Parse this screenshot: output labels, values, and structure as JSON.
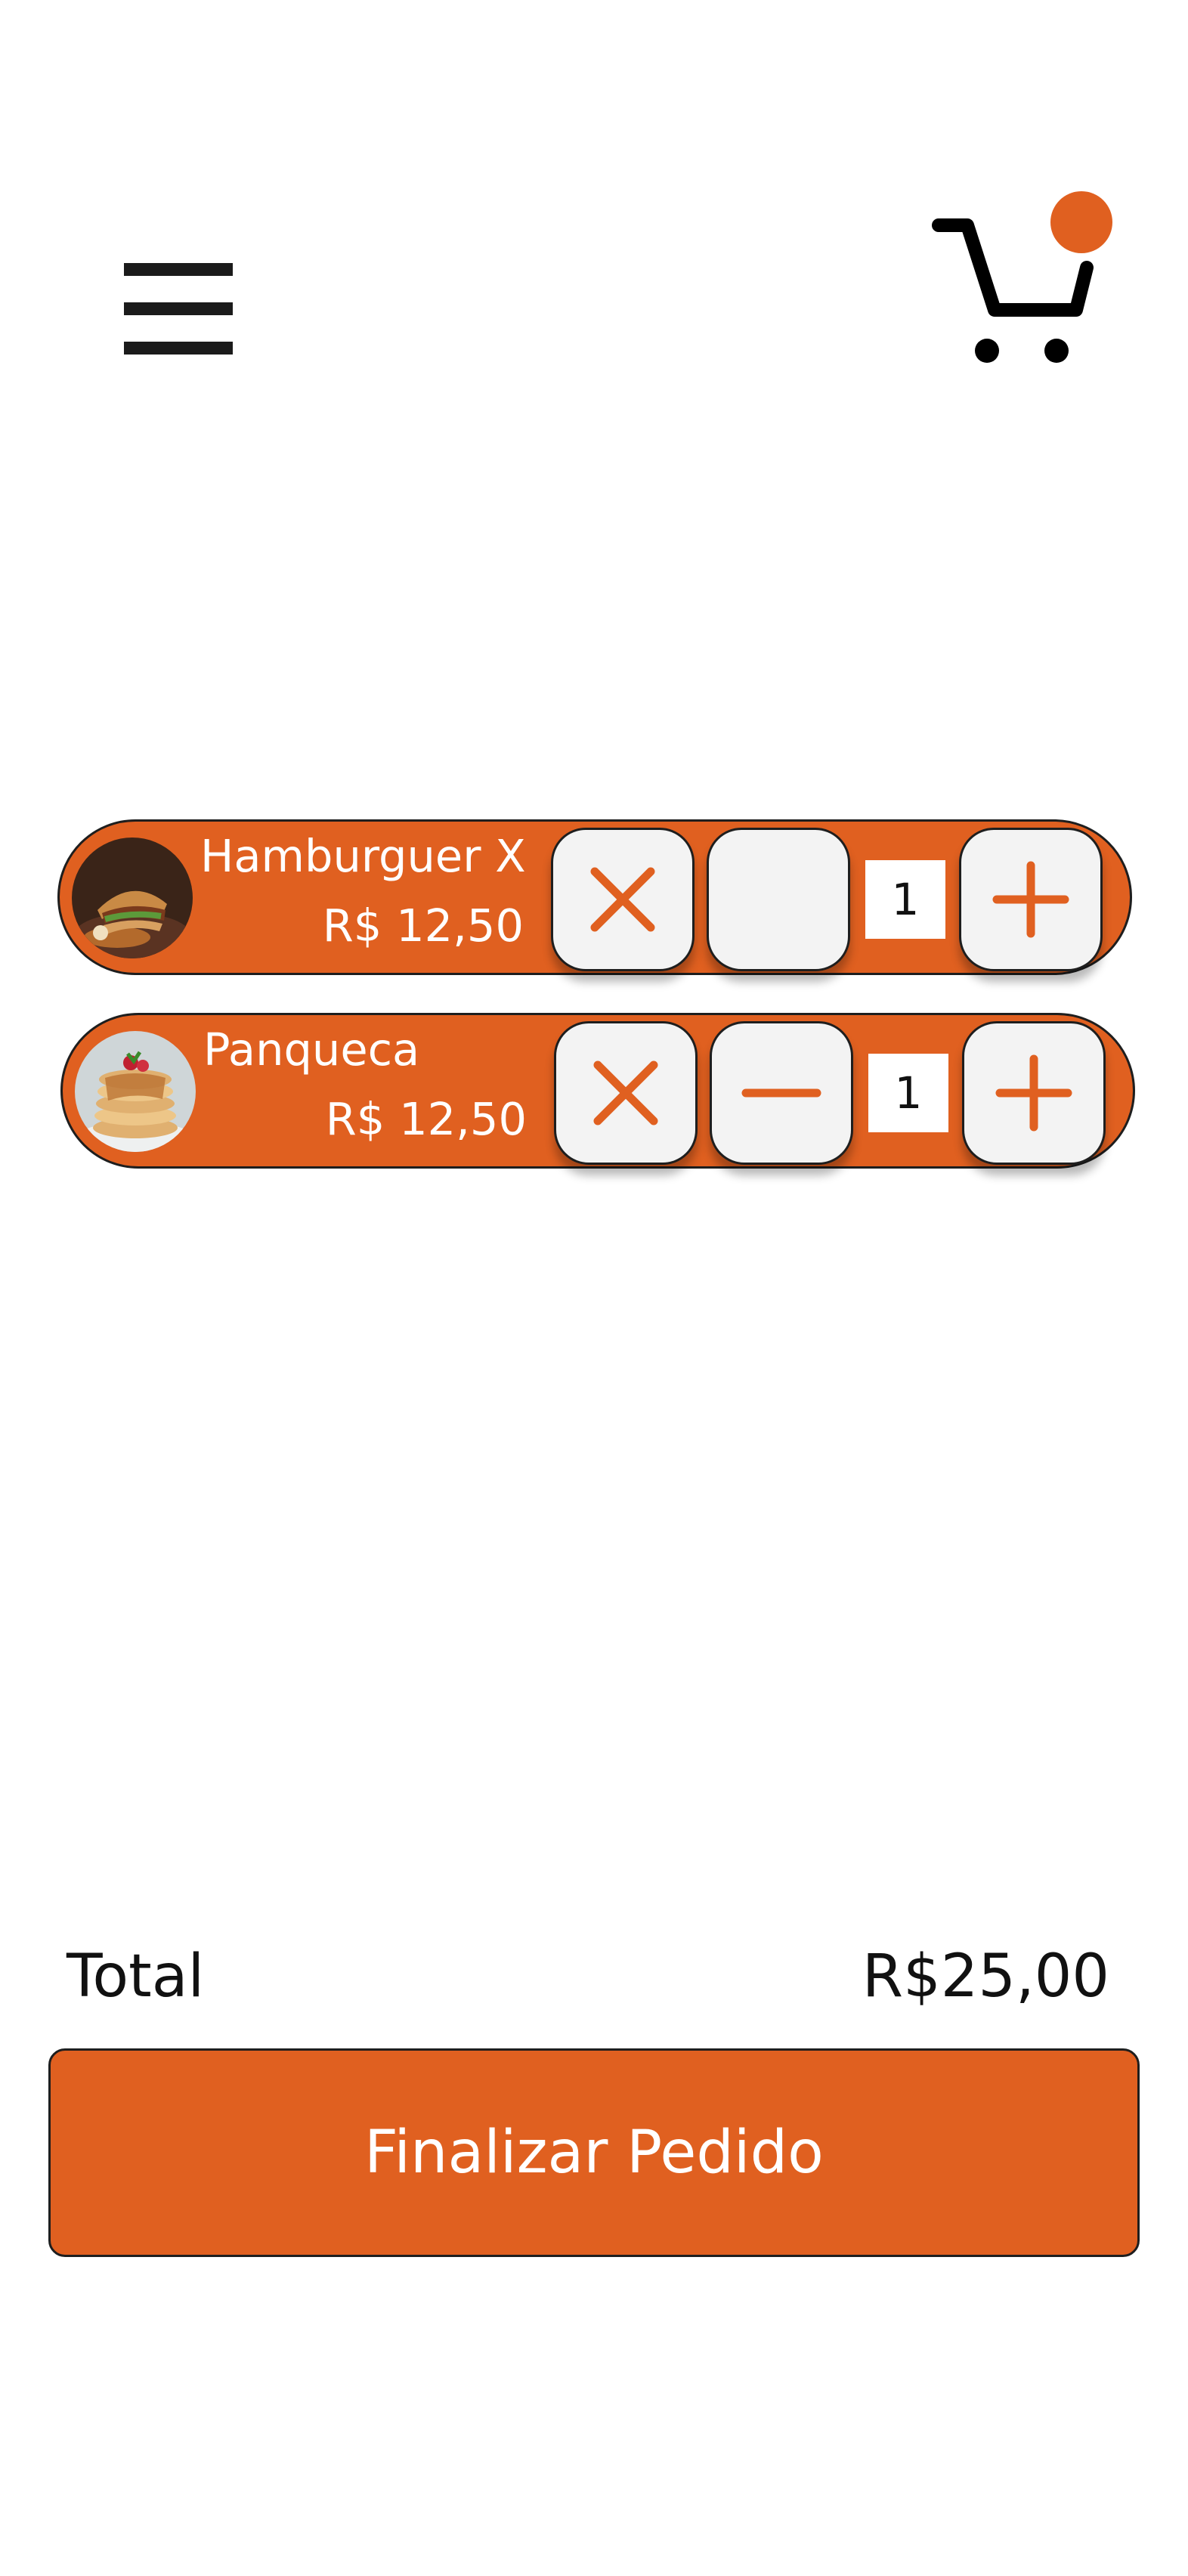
{
  "colors": {
    "accent": "#e06020",
    "button_bg": "#f3f3f3",
    "outline": "#1e1e1e",
    "text_light": "#ffffff",
    "text_dark": "#111111"
  },
  "header": {
    "menu_icon": "hamburger-menu-icon",
    "cart_icon": "shopping-cart-icon",
    "cart_badge_icon": "notification-dot"
  },
  "cart": {
    "items": [
      {
        "name": "Hamburguer X",
        "price": "R$ 12,50",
        "quantity": "1",
        "image": "hamburger-photo",
        "remove_icon": "close-icon",
        "decrease_icon": "",
        "increase_icon": "plus-icon"
      },
      {
        "name": "Panqueca",
        "price": "R$ 12,50",
        "quantity": "1",
        "image": "pancake-photo",
        "remove_icon": "close-icon",
        "decrease_icon": "minus-icon",
        "increase_icon": "plus-icon"
      }
    ]
  },
  "summary": {
    "total_label": "Total",
    "total_value": "R$25,00",
    "checkout_label": "Finalizar Pedido"
  }
}
